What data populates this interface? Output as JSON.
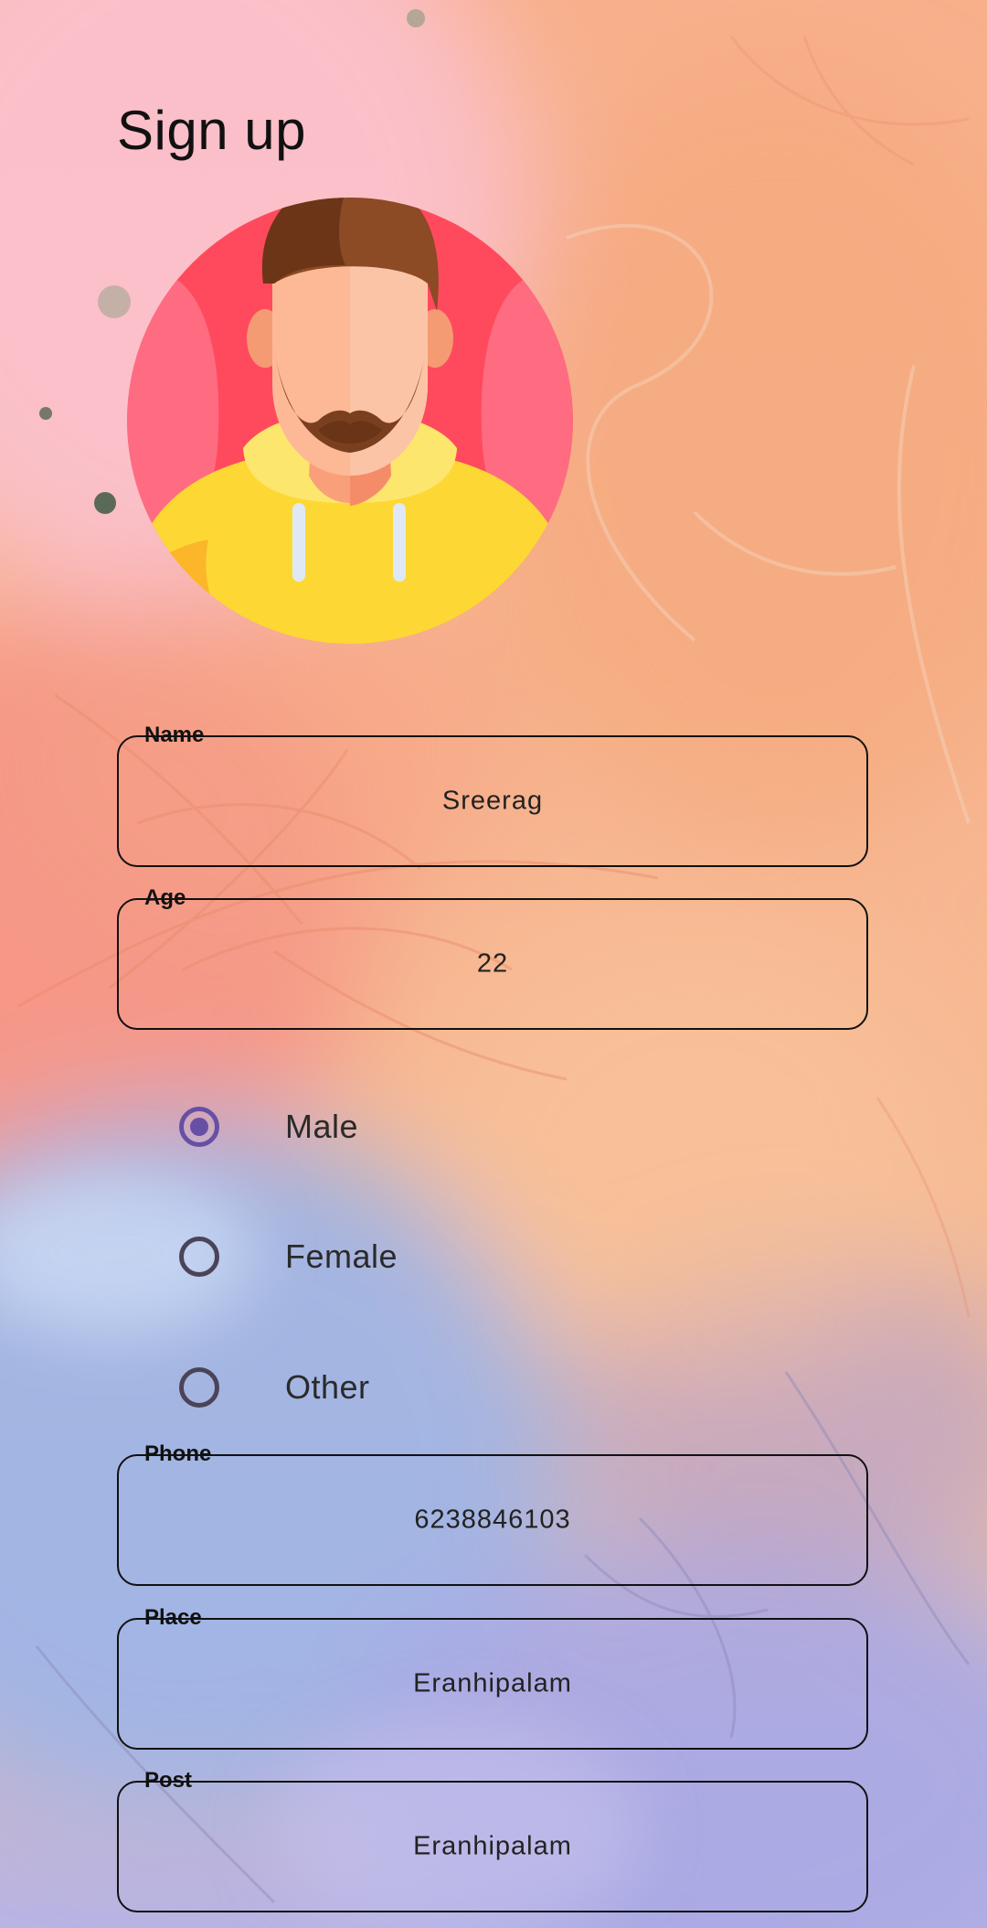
{
  "header": {
    "title": "Sign up"
  },
  "form": {
    "name": {
      "label": "Name",
      "value": "Sreerag"
    },
    "age": {
      "label": "Age",
      "value": "22"
    },
    "gender": {
      "options": [
        "Male",
        "Female",
        "Other"
      ],
      "selected": "Male"
    },
    "phone": {
      "label": "Phone",
      "value": "6238846103"
    },
    "place": {
      "label": "Place",
      "value": "Eranhipalam"
    },
    "post": {
      "label": "Post",
      "value": "Eranhipalam"
    }
  },
  "colors": {
    "accent": "#6750a4",
    "text": "#111111"
  }
}
